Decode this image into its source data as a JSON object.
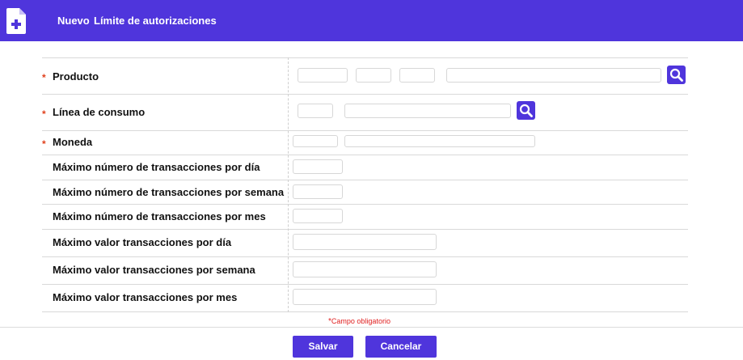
{
  "header": {
    "prefix": "Nuevo",
    "title": "Límite de autorizaciones",
    "icon": "add-document-icon",
    "background": "#4f35dc"
  },
  "form": {
    "required_marker": "*",
    "fields": [
      {
        "label": "Producto",
        "required": true
      },
      {
        "label": "Línea de consumo",
        "required": true
      },
      {
        "label": "Moneda",
        "required": true
      },
      {
        "label": "Máximo número de transacciones por día",
        "required": false
      },
      {
        "label": "Máximo número de transacciones por semana",
        "required": false
      },
      {
        "label": "Máximo número de transacciones por mes",
        "required": false
      },
      {
        "label": "Máximo valor transacciones por día",
        "required": false
      },
      {
        "label": "Máximo valor transacciones por semana",
        "required": false
      },
      {
        "label": "Máximo valor transacciones por mes",
        "required": false
      }
    ],
    "search_icon": "search-icon"
  },
  "required_note": {
    "star": "*",
    "text": "Campo obligatorio",
    "color": "#e02020"
  },
  "buttons": {
    "save": "Salvar",
    "cancel": "Cancelar"
  }
}
